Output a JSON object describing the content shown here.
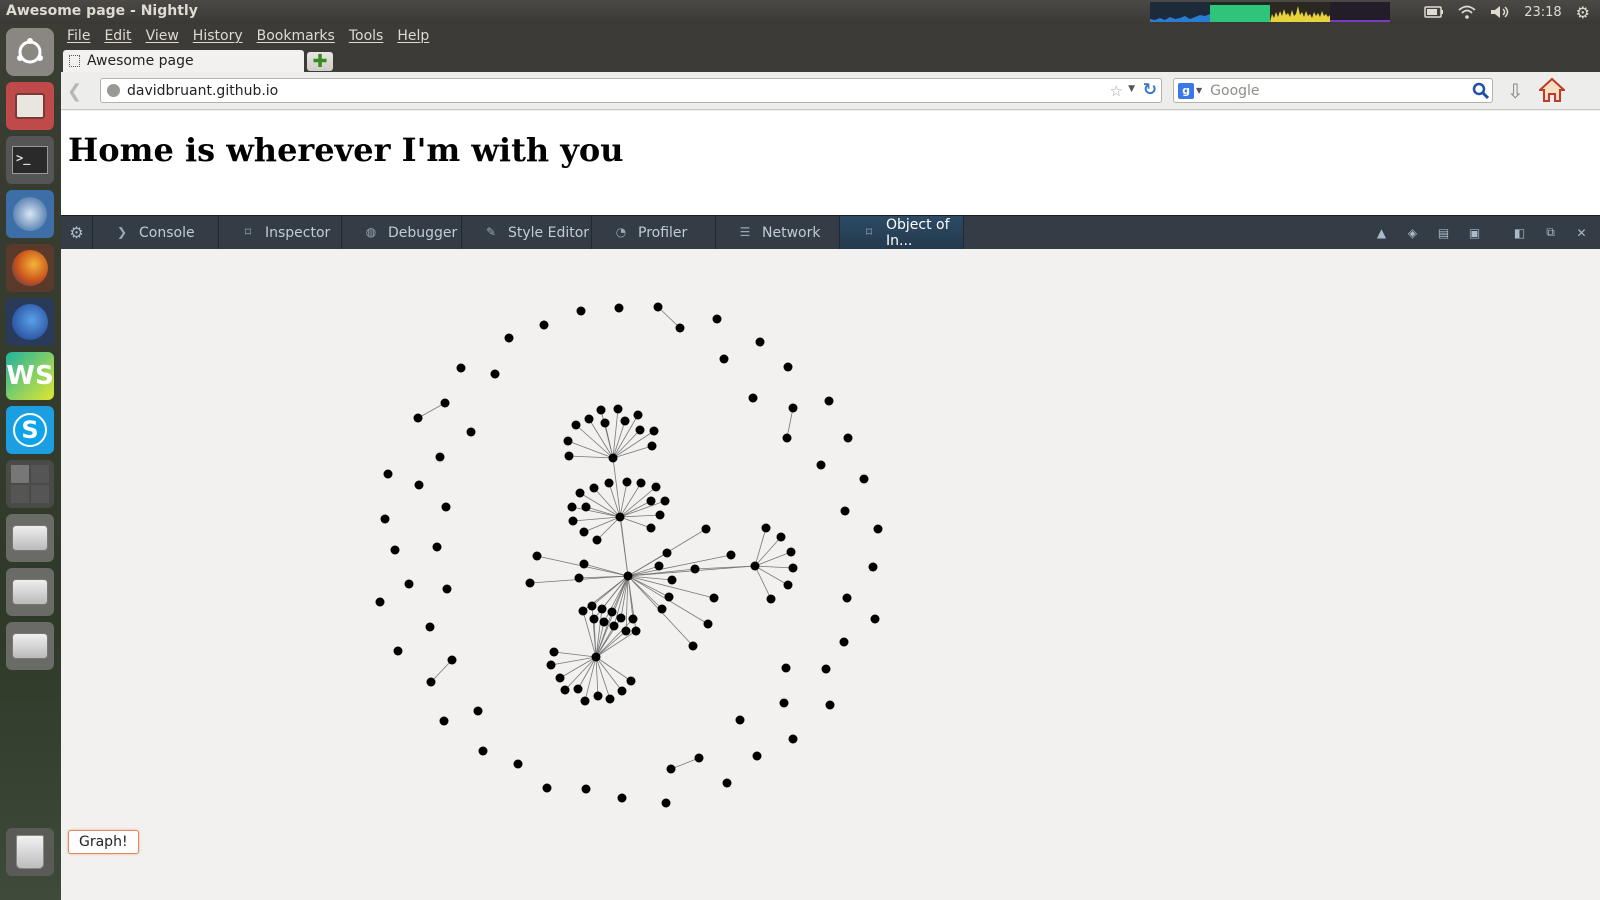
{
  "window": {
    "title": "Awesome page - Nightly"
  },
  "panel": {
    "clock": "23:18"
  },
  "menu": {
    "items": [
      "File",
      "Edit",
      "View",
      "History",
      "Bookmarks",
      "Tools",
      "Help"
    ]
  },
  "tab": {
    "title": "Awesome page"
  },
  "navbar": {
    "url": "davidbruant.github.io",
    "search_placeholder": "Google"
  },
  "page": {
    "heading": "Home is wherever I'm with you"
  },
  "devtools": {
    "tabs": [
      {
        "label": "Console",
        "icon": "console-icon"
      },
      {
        "label": "Inspector",
        "icon": "inspector-icon"
      },
      {
        "label": "Debugger",
        "icon": "debugger-icon"
      },
      {
        "label": "Style Editor",
        "icon": "style-editor-icon"
      },
      {
        "label": "Profiler",
        "icon": "profiler-icon"
      },
      {
        "label": "Network",
        "icon": "network-icon"
      },
      {
        "label": "Object of In...",
        "icon": "object-icon",
        "active": true
      }
    ]
  },
  "graph_button": {
    "label": "Graph!"
  },
  "colors": {
    "accent_active_tab": "#2c4b65",
    "devtools_bg": "#343c45",
    "node": "#000000",
    "button_border": "#e08a62"
  }
}
